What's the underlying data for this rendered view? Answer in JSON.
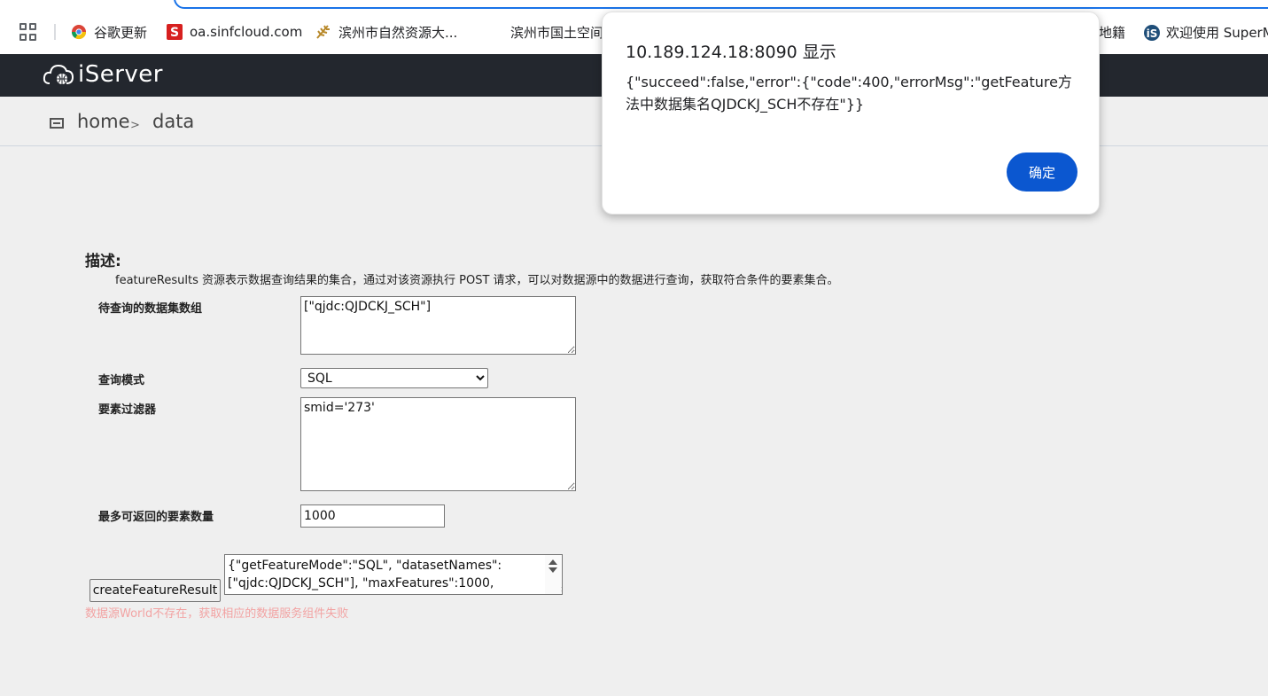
{
  "bookmarks": [
    {
      "label": "谷歌更新",
      "icon": "chrome-icon"
    },
    {
      "label": "oa.sinfcloud.com",
      "icon": "sinfcloud-icon"
    },
    {
      "label": "滨州市自然资源大...",
      "icon": "wheat-icon"
    },
    {
      "label": "滨州市国土空间",
      "icon": ""
    },
    {
      "label": "地籍",
      "icon": ""
    },
    {
      "label": "欢迎使用 SuperM",
      "icon": "supermap-icon"
    }
  ],
  "header": {
    "logo_text": "iServer"
  },
  "breadcrumb": {
    "home": "home",
    "arrow": ">",
    "current": "data"
  },
  "description": {
    "title": "描述:",
    "text": "featureResults 资源表示数据查询结果的集合，通过对该资源执行 POST 请求，可以对数据源中的数据进行查询，获取符合条件的要素集合。"
  },
  "form": {
    "dataset_label": "待查询的数据集数组",
    "dataset_value": "[\"qjdc:QJDCKJ_SCH\"]",
    "mode_label": "查询模式",
    "mode_value": "SQL",
    "filter_label": "要素过滤器",
    "filter_value": "smid='273'",
    "max_label": "最多可返回的要素数量",
    "max_value": "1000",
    "create_button": "createFeatureResult",
    "request_body": "{\"getFeatureMode\":\"SQL\", \"datasetNames\":[\"qjdc:QJDCKJ_SCH\"], \"maxFeatures\":1000,",
    "error_text": "数据源World不存在，获取相应的数据服务组件失败"
  },
  "dialog": {
    "title": "10.189.124.18:8090 显示",
    "message": "{\"succeed\":false,\"error\":{\"code\":400,\"errorMsg\":\"getFeature方法中数据集名QJDCKJ_SCH不存在\"}}",
    "ok_button": "确定"
  }
}
